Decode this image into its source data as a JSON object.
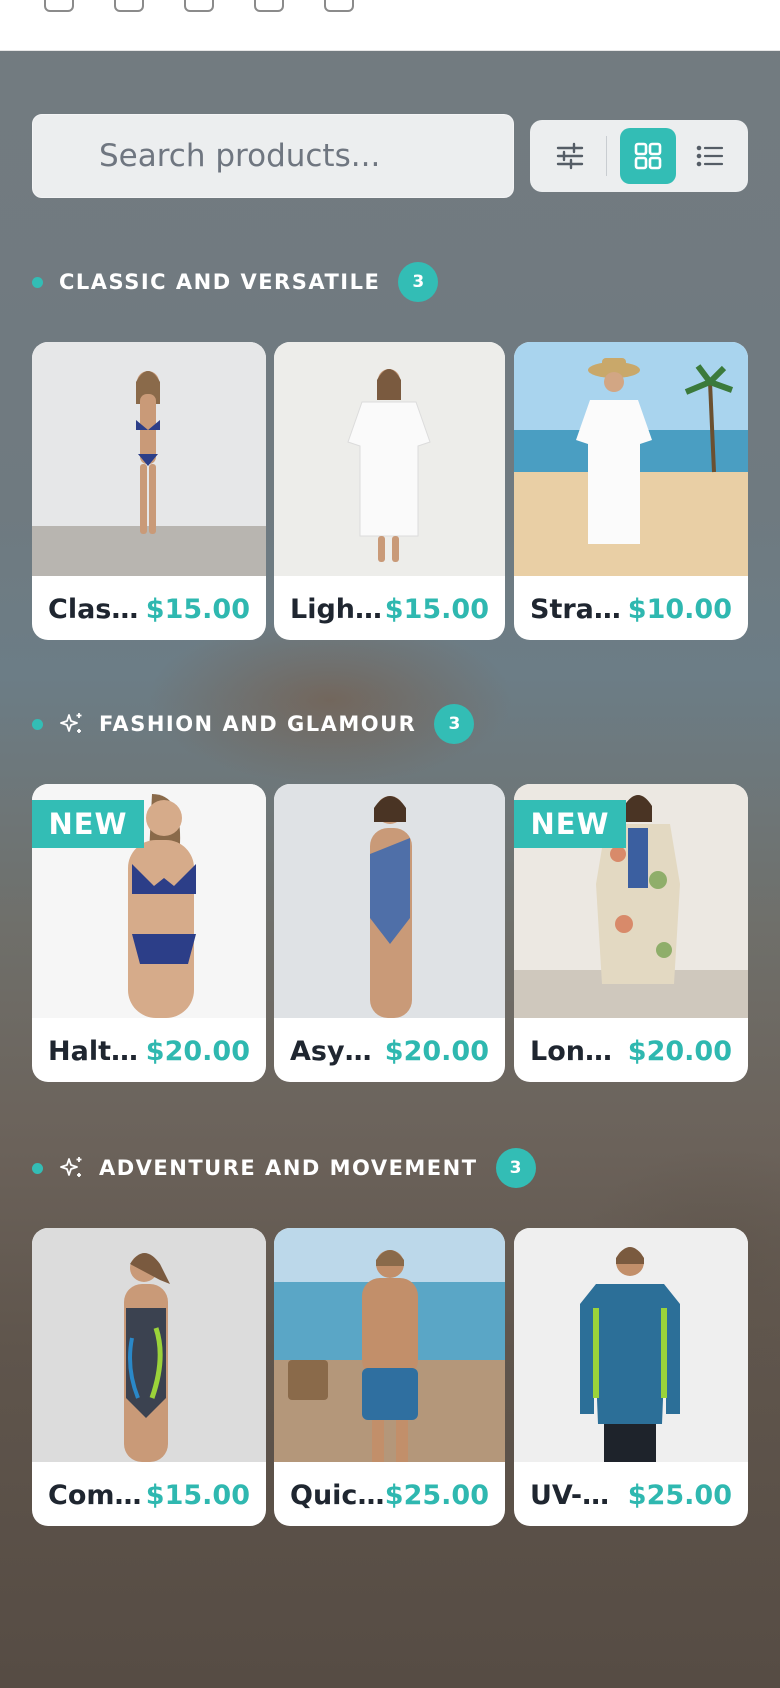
{
  "search": {
    "placeholder": "Search products..."
  },
  "view_toggle": {
    "filter_icon": "sliders-icon",
    "grid_icon": "grid-icon",
    "list_icon": "list-icon",
    "active": "grid"
  },
  "colors": {
    "accent": "#33bdb5",
    "price": "#2fb8b0",
    "card": "#ffffff"
  },
  "sections": [
    {
      "title": "CLASSIC AND VERSATILE",
      "count": "3",
      "icon": "",
      "products": [
        {
          "name": "Classic Bikini",
          "price": "$15.00",
          "badge": ""
        },
        {
          "name": "Lightweight Cover-Up",
          "price": "$15.00",
          "badge": ""
        },
        {
          "name": "Straw Hat Beach Dress",
          "price": "$10.00",
          "badge": ""
        }
      ]
    },
    {
      "title": "FASHION AND GLAMOUR",
      "count": "3",
      "icon": "sparkle-icon",
      "products": [
        {
          "name": "Halter Bikini",
          "price": "$20.00",
          "badge": "NEW"
        },
        {
          "name": "Asymmetric One-Piece",
          "price": "$20.00",
          "badge": ""
        },
        {
          "name": "Long Kimono",
          "price": "$20.00",
          "badge": "NEW"
        }
      ]
    },
    {
      "title": "ADVENTURE AND MOVEMENT",
      "count": "3",
      "icon": "sparkle-icon",
      "products": [
        {
          "name": "Competition Swimsuit",
          "price": "$15.00",
          "badge": ""
        },
        {
          "name": "Quick-Dry Swim Shorts",
          "price": "$25.00",
          "badge": ""
        },
        {
          "name": "UV-Protection Rash Guard",
          "price": "$25.00",
          "badge": ""
        }
      ]
    }
  ]
}
